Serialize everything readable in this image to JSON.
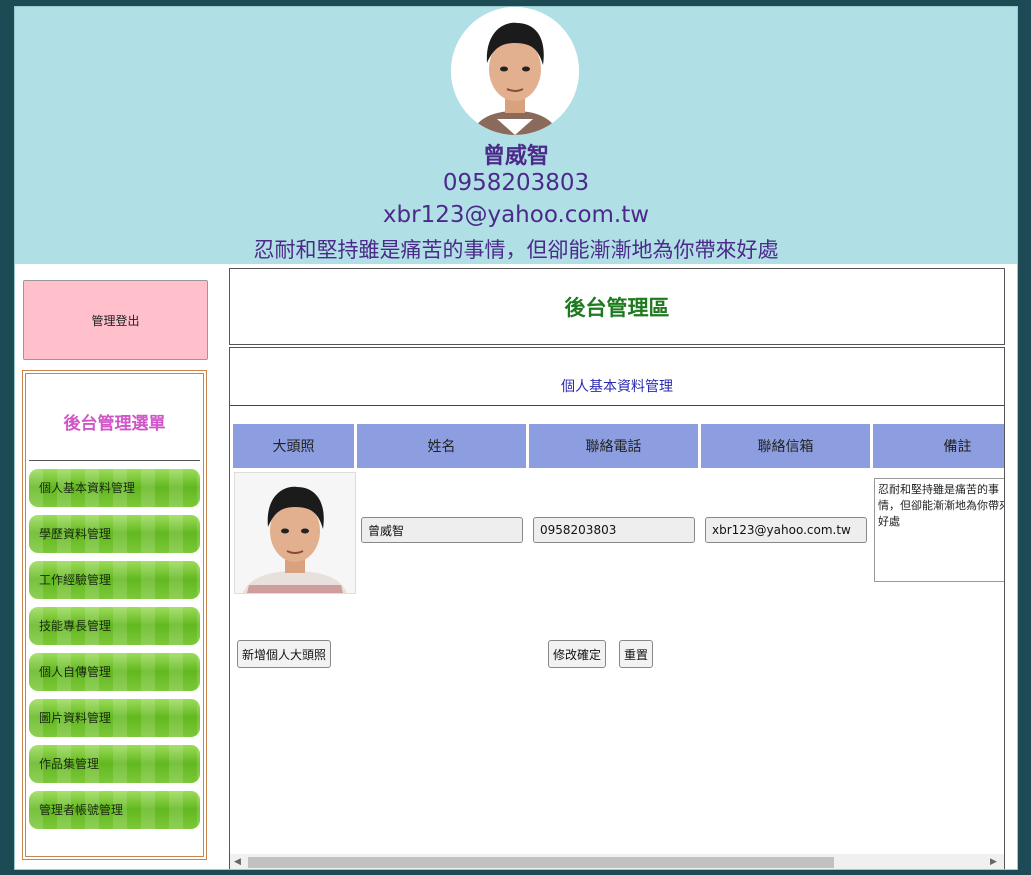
{
  "header": {
    "name": "曾威智",
    "phone": "0958203803",
    "email": "xbr123@yahoo.com.tw",
    "motto": "忍耐和堅持雖是痛苦的事情，但卻能漸漸地為你帶來好處"
  },
  "sidebar": {
    "logout_label": "管理登出",
    "menu_title": "後台管理選單",
    "items": [
      {
        "label": "個人基本資料管理"
      },
      {
        "label": "學歷資料管理"
      },
      {
        "label": "工作經驗管理"
      },
      {
        "label": "技能專長管理"
      },
      {
        "label": "個人自傳管理"
      },
      {
        "label": "圖片資料管理"
      },
      {
        "label": "作品集管理"
      },
      {
        "label": "管理者帳號管理"
      }
    ]
  },
  "main": {
    "title": "後台管理區",
    "section_title": "個人基本資料管理",
    "columns": [
      "大頭照",
      "姓名",
      "聯絡電話",
      "聯絡信箱",
      "備註"
    ],
    "form": {
      "name": "曾威智",
      "phone": "0958203803",
      "email": "xbr123@yahoo.com.tw",
      "note": "忍耐和堅持雖是痛苦的事情，但卻能漸漸地為你帶來好處"
    },
    "buttons": {
      "add_photo": "新增個人大頭照",
      "confirm": "修改確定",
      "reset": "重置"
    }
  },
  "colors": {
    "header_bg": "#b0e0e6",
    "header_text": "#4b2a8a",
    "logout_bg": "#ffc0cb",
    "menu_title": "#d155c7",
    "menu_item": "#62b81f",
    "main_title": "#1e7a1e",
    "section_title": "#2a2ab0",
    "table_header": "#8c9ee0"
  }
}
